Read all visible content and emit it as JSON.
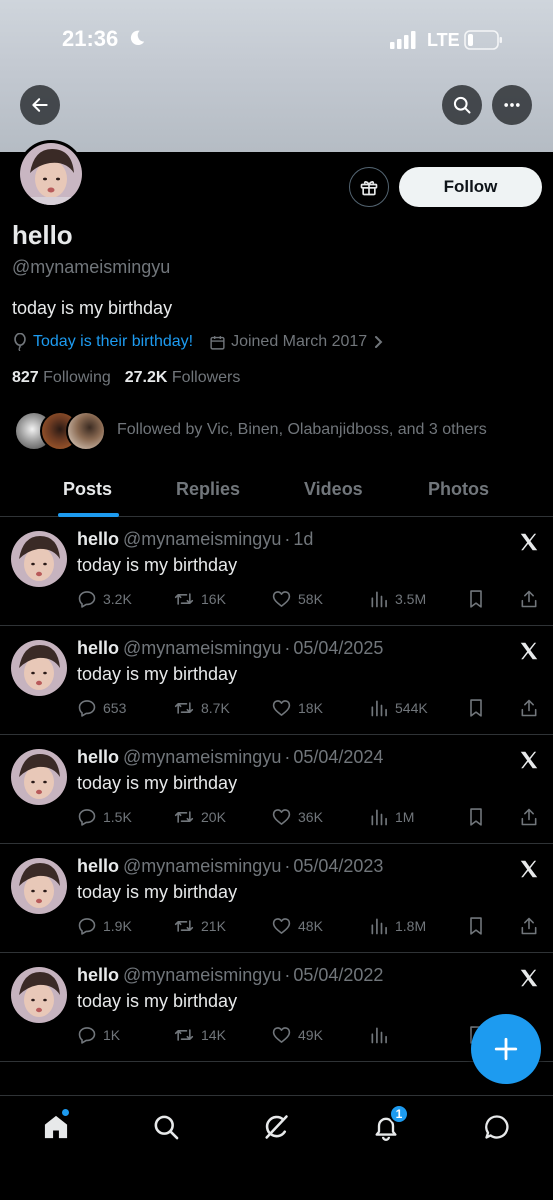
{
  "status_bar": {
    "time": "21:36",
    "network": "LTE"
  },
  "profile": {
    "name": "hello",
    "handle": "@mynameismingyu",
    "bio": "today is my birthday",
    "birthday_text": "Today is their birthday!",
    "joined_text": "Joined March 2017",
    "following_count": "827",
    "following_label": "Following",
    "followers_count": "27.2K",
    "followers_label": "Followers",
    "followed_by_text": "Followed by Vic, Binen, Olabanjidboss, and 3 others"
  },
  "buttons": {
    "follow_label": "Follow"
  },
  "tabs": [
    {
      "label": "Posts",
      "active": true
    },
    {
      "label": "Replies",
      "active": false
    },
    {
      "label": "Videos",
      "active": false
    },
    {
      "label": "Photos",
      "active": false
    }
  ],
  "posts": [
    {
      "name": "hello",
      "handle": "@mynameismingyu",
      "dot": "·",
      "time": "1d",
      "text": "today is my birthday",
      "replies": "3.2K",
      "reposts": "16K",
      "likes": "58K",
      "views": "3.5M"
    },
    {
      "name": "hello",
      "handle": "@mynameismingyu",
      "dot": "·",
      "time": "05/04/2025",
      "text": "today is my birthday",
      "replies": "653",
      "reposts": "8.7K",
      "likes": "18K",
      "views": "544K"
    },
    {
      "name": "hello",
      "handle": "@mynameismingyu",
      "dot": "·",
      "time": "05/04/2024",
      "text": "today is my birthday",
      "replies": "1.5K",
      "reposts": "20K",
      "likes": "36K",
      "views": "1M"
    },
    {
      "name": "hello",
      "handle": "@mynameismingyu",
      "dot": "·",
      "time": "05/04/2023",
      "text": "today is my birthday",
      "replies": "1.9K",
      "reposts": "21K",
      "likes": "48K",
      "views": "1.8M"
    },
    {
      "name": "hello",
      "handle": "@mynameismingyu",
      "dot": "·",
      "time": "05/04/2022",
      "text": "today is my birthday",
      "replies": "1K",
      "reposts": "14K",
      "likes": "49K",
      "views": ""
    }
  ],
  "bottom_nav": {
    "items": [
      "home-icon",
      "search-icon",
      "grok-icon",
      "notifications-icon",
      "messages-icon"
    ],
    "notifications_badge": "1"
  },
  "colors": {
    "accent": "#1d9bf0",
    "background": "#000000",
    "muted": "#71767b",
    "text": "#e7e9ea"
  }
}
